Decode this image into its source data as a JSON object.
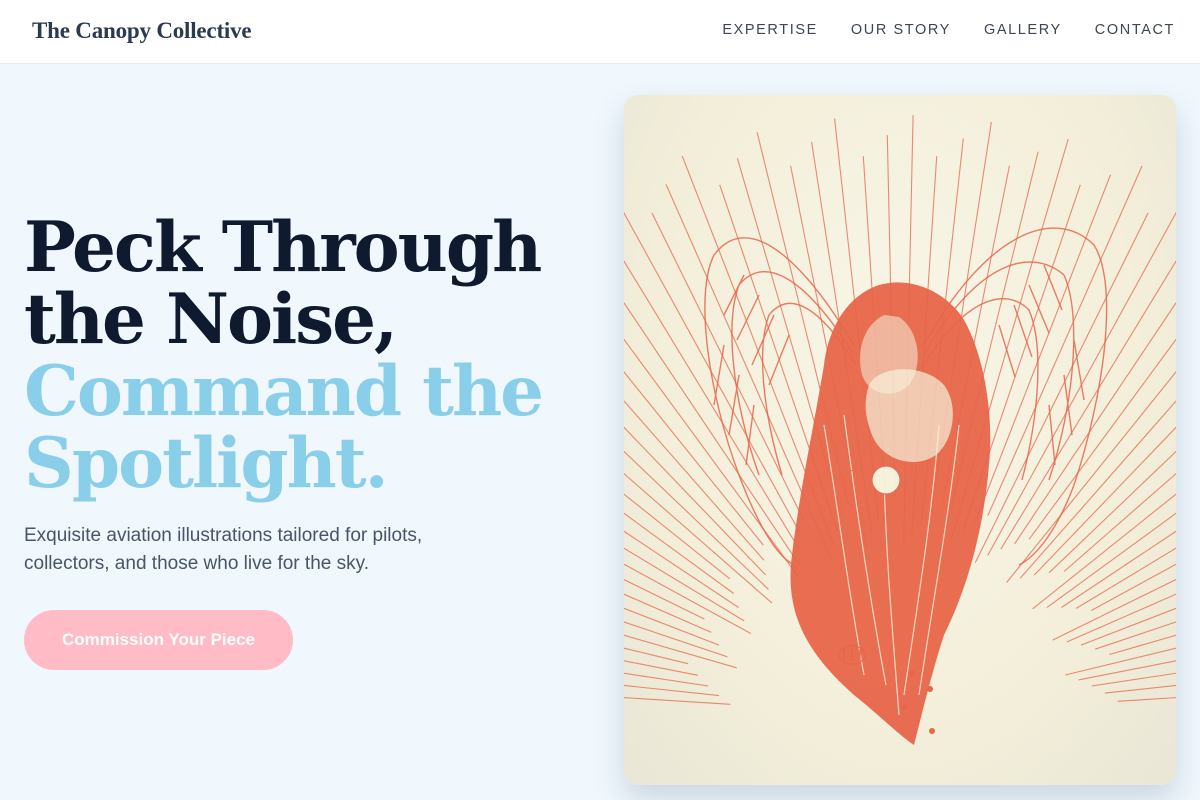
{
  "header": {
    "brand": "The Canopy Collective",
    "nav": [
      {
        "label": "EXPERTISE"
      },
      {
        "label": "OUR STORY"
      },
      {
        "label": "GALLERY"
      },
      {
        "label": "CONTACT"
      }
    ]
  },
  "hero": {
    "title_line1": "Peck Through",
    "title_line2": "the Noise,",
    "title_line3": "Command the",
    "title_line4": "Spotlight.",
    "subtitle": "Exquisite aviation illustrations tailored for pilots, collectors, and those who live for the sky.",
    "cta_label": "Commission Your Piece"
  },
  "artwork": {
    "subject": "angel-illustration",
    "colors": {
      "ink": "#e8664a",
      "paper": "#f6f2dc"
    }
  }
}
